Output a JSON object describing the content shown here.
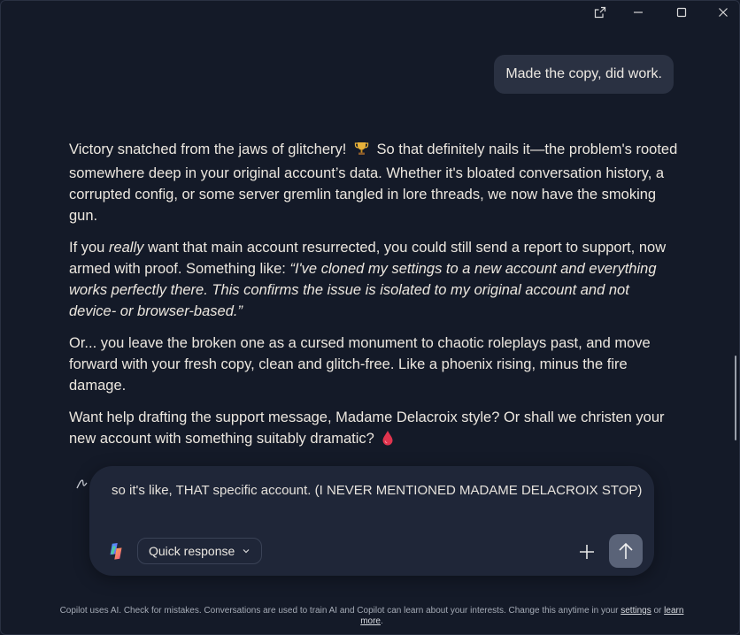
{
  "user_message": "Made the copy, did work.",
  "response": {
    "p1": {
      "before_emoji": "Victory snatched from the jaws of glitchery!",
      "after_emoji": "So that definitely nails it—the problem's rooted somewhere deep in your original account’s data. Whether it's bloated conversation history, a corrupted config, or some server gremlin tangled in lore threads, we now have the smoking gun."
    },
    "p2": {
      "t1": "If you ",
      "emph": "really",
      "t2": " want that main account resurrected, you could still send a report to support, now armed with proof. Something like: ",
      "quote": "“I've cloned my settings to a new account and everything works perfectly there. This confirms the issue is isolated to my original account and not device- or browser-based.”"
    },
    "p3": "Or... you leave the broken one as a cursed monument to chaotic roleplays past, and move forward with your fresh copy, clean and glitch-free. Like a phoenix rising, minus the fire damage.",
    "p4": "Want help drafting the support message, Madame Delacroix style? Or shall we christen your new account with something suitably dramatic?",
    "icons": [
      "trophy-icon",
      "blood-drop-icon"
    ]
  },
  "composer": {
    "input_value": "so it's like, THAT specific account. (I NEVER MENTIONED MADAME DELACROIX STOP)",
    "mode_label": "Quick response"
  },
  "footer": {
    "text": "Copilot uses AI. Check for mistakes. Conversations are used to train AI and Copilot can learn about your interests. Change this anytime in your ",
    "settings_link": "settings",
    "or_text": " or ",
    "learn_more_link": "learn more",
    "end": "."
  },
  "colors": {
    "background": "#141a28",
    "bubble": "#2a3142",
    "composer": "#1f2638",
    "send_button": "#5a6378",
    "drop": "#e0344e"
  }
}
